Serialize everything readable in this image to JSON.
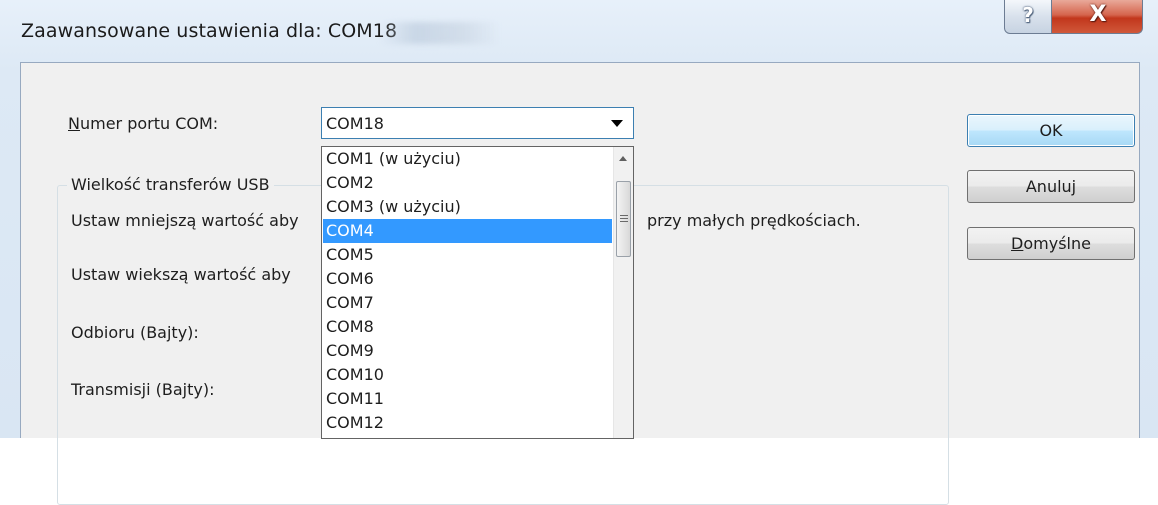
{
  "window": {
    "title": "Zaawansowane ustawienia dla: COM18",
    "help_icon": "question-mark-icon",
    "help_glyph": "?",
    "close_icon": "close-x-icon",
    "close_glyph": "X"
  },
  "port": {
    "label_prefix": "",
    "label_mnemonic": "N",
    "label_rest": "umer portu COM:",
    "selected_value": "COM18",
    "dropdown_arrow_icon": "chevron-down-icon",
    "options": [
      "COM1 (w użyciu)",
      "COM2",
      "COM3 (w użyciu)",
      "COM4",
      "COM5",
      "COM6",
      "COM7",
      "COM8",
      "COM9",
      "COM10",
      "COM11",
      "COM12"
    ],
    "highlighted_option": "COM4",
    "highlight_color": "#3399ff"
  },
  "usb_group": {
    "title": "Wielkość transferów USB",
    "hint_low_left": "Ustaw mniejszą wartość aby",
    "hint_low_right": "przy małych prędkościach.",
    "hint_high_left": "Ustaw wiekszą wartość aby",
    "receive_label": "Odbioru (Bajty):",
    "transmit_label": "Transmisji (Bajty):"
  },
  "buttons": {
    "ok_label": "OK",
    "cancel_label": "Anuluj",
    "defaults_mnemonic": "D",
    "defaults_rest": "omyślne"
  },
  "colors": {
    "close_button": "#c2371c",
    "default_button_border": "#3c7fb1",
    "window_frame": "#dde9f5"
  }
}
